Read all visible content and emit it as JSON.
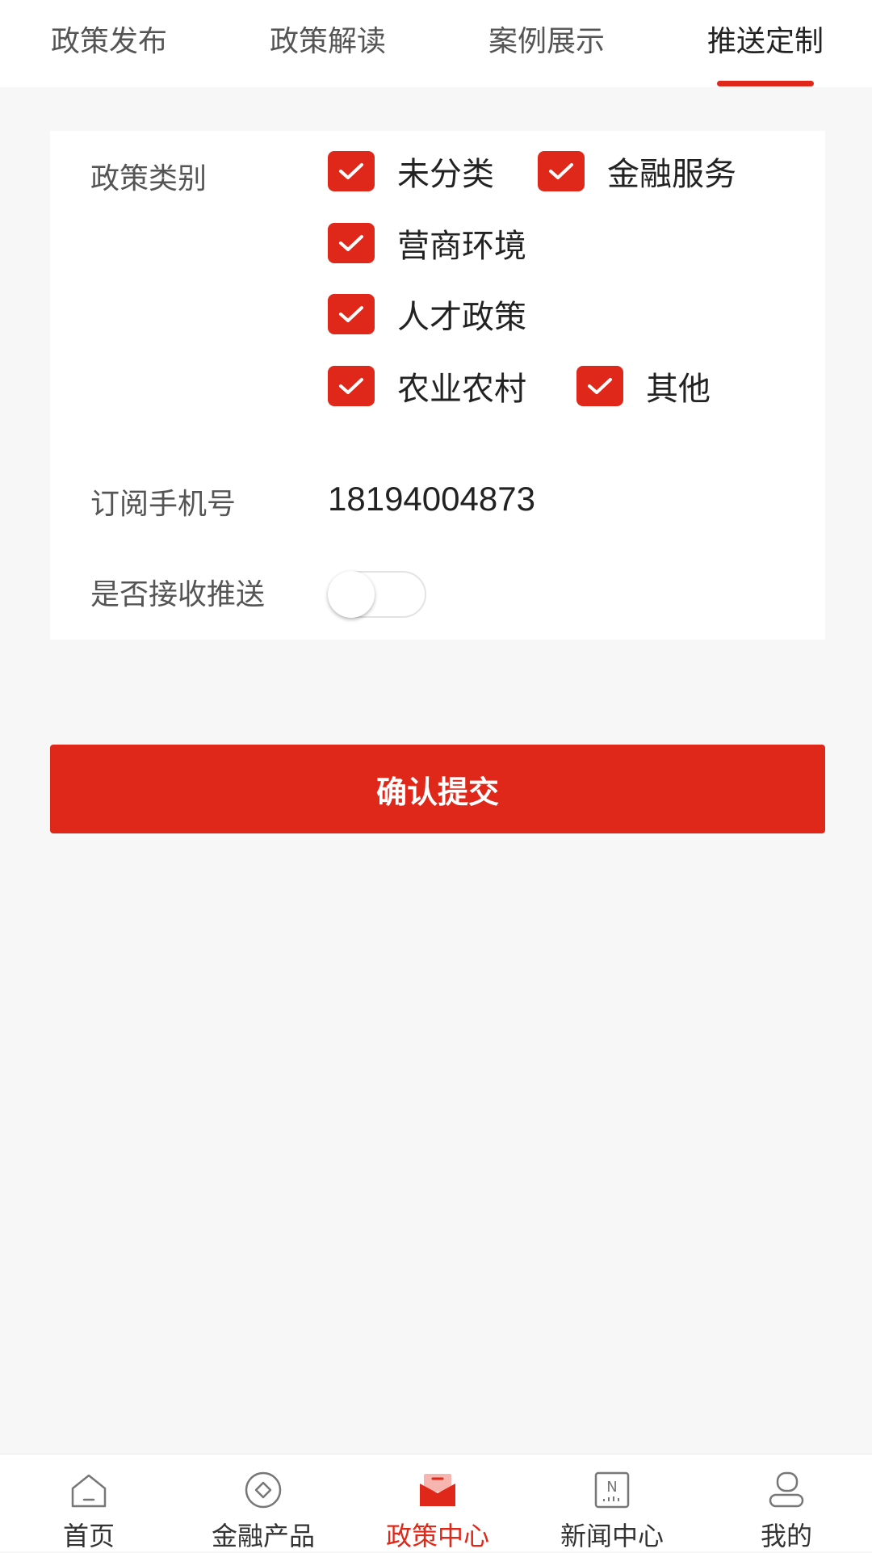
{
  "tabs": [
    {
      "label": "政策发布",
      "active": false
    },
    {
      "label": "政策解读",
      "active": false
    },
    {
      "label": "案例展示",
      "active": false
    },
    {
      "label": "推送定制",
      "active": true
    }
  ],
  "form": {
    "category_label": "政策类别",
    "categories": [
      {
        "label": "未分类",
        "checked": true
      },
      {
        "label": "金融服务",
        "checked": true
      },
      {
        "label": "营商环境",
        "checked": true
      },
      {
        "label": "人才政策",
        "checked": true
      },
      {
        "label": "农业农村",
        "checked": true
      },
      {
        "label": "其他",
        "checked": true
      }
    ],
    "phone_label": "订阅手机号",
    "phone_value": "18194004873",
    "push_label": "是否接收推送",
    "push_enabled": false
  },
  "submit_label": "确认提交",
  "bottom_nav": [
    {
      "label": "首页",
      "icon": "home-icon",
      "active": false
    },
    {
      "label": "金融产品",
      "icon": "finance-icon",
      "active": false
    },
    {
      "label": "政策中心",
      "icon": "policy-icon",
      "active": true
    },
    {
      "label": "新闻中心",
      "icon": "news-icon",
      "active": false
    },
    {
      "label": "我的",
      "icon": "user-icon",
      "active": false
    }
  ],
  "colors": {
    "accent": "#e0281a",
    "background": "#f7f7f7"
  }
}
